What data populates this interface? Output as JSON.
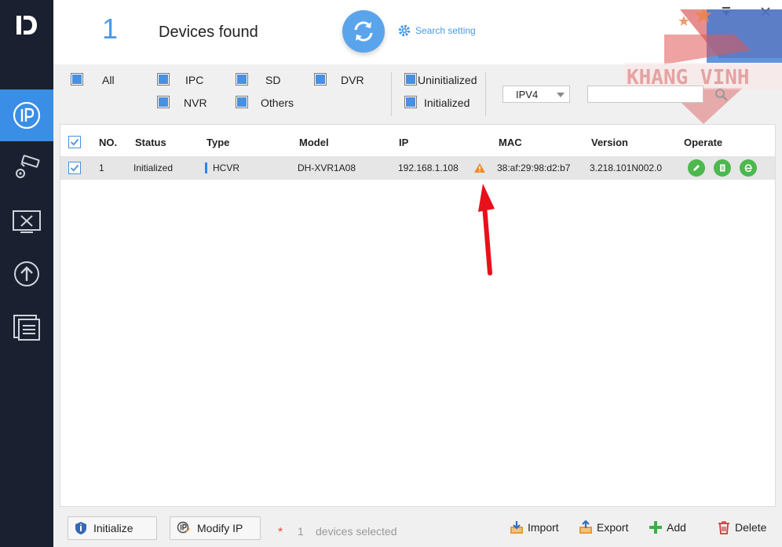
{
  "header": {
    "device_count": "1",
    "devices_found_label": "Devices found",
    "search_setting_label": "Search setting"
  },
  "watermark": {
    "text": "KHANG VINH"
  },
  "filters": {
    "all": "All",
    "ipc": "IPC",
    "sd": "SD",
    "dvr": "DVR",
    "nvr": "NVR",
    "others": "Others",
    "uninitialized": "Uninitialized",
    "initialized": "Initialized",
    "ip_version": "IPV4",
    "search_placeholder": ""
  },
  "table": {
    "columns": {
      "no": "NO.",
      "status": "Status",
      "type": "Type",
      "model": "Model",
      "ip": "IP",
      "mac": "MAC",
      "version": "Version",
      "operate": "Operate"
    },
    "rows": [
      {
        "no": "1",
        "status": "Initialized",
        "type": "HCVR",
        "model": "DH-XVR1A08",
        "ip": "192.168.1.108",
        "mac": "38:af:29:98:d2:b7",
        "version": "3.218.101N002.0",
        "checked": true,
        "warning_icon": "warning-icon"
      }
    ]
  },
  "footer": {
    "initialize_label": "Initialize",
    "modify_ip_label": "Modify IP",
    "selected_count": "1",
    "selected_label": "devices selected",
    "import_label": "Import",
    "export_label": "Export",
    "add_label": "Add",
    "delete_label": "Delete"
  },
  "sidebar": {
    "items": [
      {
        "icon": "ip-config-icon",
        "active": true
      },
      {
        "icon": "camera-settings-icon",
        "active": false
      },
      {
        "icon": "system-tools-icon",
        "active": false
      },
      {
        "icon": "upgrade-icon",
        "active": false
      },
      {
        "icon": "document-list-icon",
        "active": false
      }
    ]
  },
  "colors": {
    "accent": "#4a9ae8",
    "sidebar_bg": "#1b2030",
    "sidebar_active": "#3a8ee6",
    "operate_green": "#4cb84e",
    "arrow_red": "#e8101a",
    "warning_orange": "#f08a24"
  }
}
